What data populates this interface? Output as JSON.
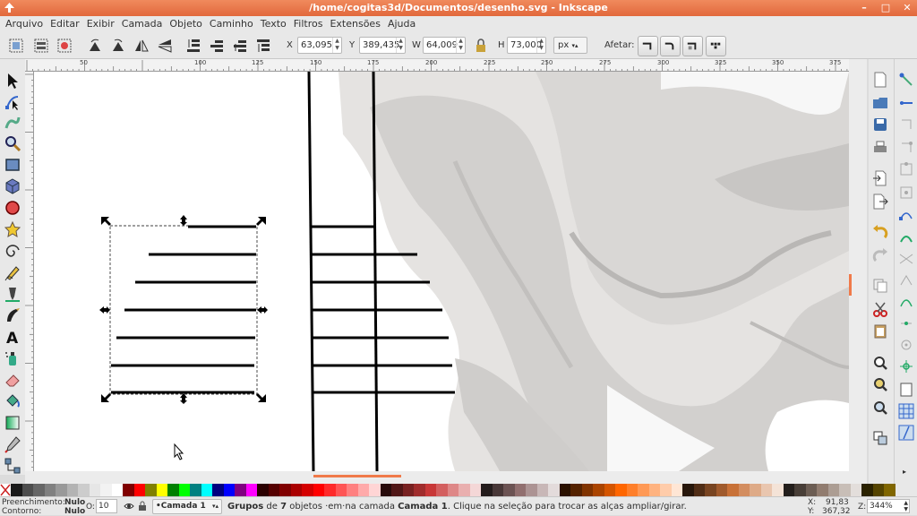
{
  "window": {
    "title": "/home/cogitas3d/Documentos/desenho.svg - Inkscape"
  },
  "menu": [
    "Arquivo",
    "Editar",
    "Exibir",
    "Camada",
    "Objeto",
    "Caminho",
    "Texto",
    "Filtros",
    "Extensões",
    "Ajuda"
  ],
  "controls": {
    "x_label": "X",
    "x_value": "63,095",
    "y_label": "Y",
    "y_value": "389,435",
    "w_label": "W",
    "w_value": "64,009",
    "h_label": "H",
    "h_value": "73,000",
    "unit": "px",
    "affect_label": "Afetar:"
  },
  "ruler": {
    "labels": [
      "50",
      "100",
      "125",
      "150",
      "175",
      "200",
      "225",
      "250",
      "275",
      "300",
      "325",
      "350",
      "375"
    ]
  },
  "palette": [
    "#1a1a1a",
    "#4d4d4d",
    "#666666",
    "#808080",
    "#999999",
    "#b3b3b3",
    "#cccccc",
    "#e6e6e6",
    "#f2f2f2",
    "#ffffff",
    "#800000",
    "#ff0000",
    "#808000",
    "#ffff00",
    "#008000",
    "#00ff00",
    "#008080",
    "#00ffff",
    "#000080",
    "#0000ff",
    "#800080",
    "#ff00ff",
    "#2b0000",
    "#550000",
    "#800000",
    "#aa0000",
    "#d40000",
    "#ff0000",
    "#ff2a2a",
    "#ff5555",
    "#ff8080",
    "#ffaaaa",
    "#ffd5d5",
    "#280b0b",
    "#501616",
    "#782121",
    "#a02c2c",
    "#c83737",
    "#d35f5f",
    "#de8787",
    "#e9afaf",
    "#f4d7d7",
    "#241c1c",
    "#483737",
    "#6c5353",
    "#916f6f",
    "#ac9393",
    "#c8b7b7",
    "#e3dbdb",
    "#2b1100",
    "#552200",
    "#803300",
    "#aa4400",
    "#d45500",
    "#ff6600",
    "#ff7f2a",
    "#ff9955",
    "#ffb380",
    "#ffccaa",
    "#ffe6d5",
    "#28170b",
    "#502d16",
    "#784421",
    "#a05a2c",
    "#c87137",
    "#d38d5f",
    "#deaa87",
    "#e9c6af",
    "#f4e3d7",
    "#241f1c",
    "#483e37",
    "#6c5d53",
    "#917c6f",
    "#ac9d93",
    "#c8beb7",
    "#e3dedb",
    "#2b2200",
    "#554400",
    "#806600"
  ],
  "status": {
    "fill_label": "Preenchimento:",
    "fill_value": "Nulo",
    "stroke_label": "Contorno:",
    "stroke_value": "Nulo",
    "opacity_label": "O:",
    "opacity_value": "10",
    "layer": "•Camada 1",
    "msg_strong1": "Grupos",
    "msg_1": " de ",
    "msg_strong2": "7",
    "msg_2": " objetos ·em·na camada ",
    "msg_strong3": "Camada 1",
    "msg_3": ". Clique na seleção para trocar as alças ampliar/girar.",
    "coord_x_label": "X:",
    "coord_x": "91,83",
    "coord_y_label": "Y:",
    "coord_y": "367,32",
    "zoom_label": "Z:",
    "zoom_value": "344%"
  }
}
